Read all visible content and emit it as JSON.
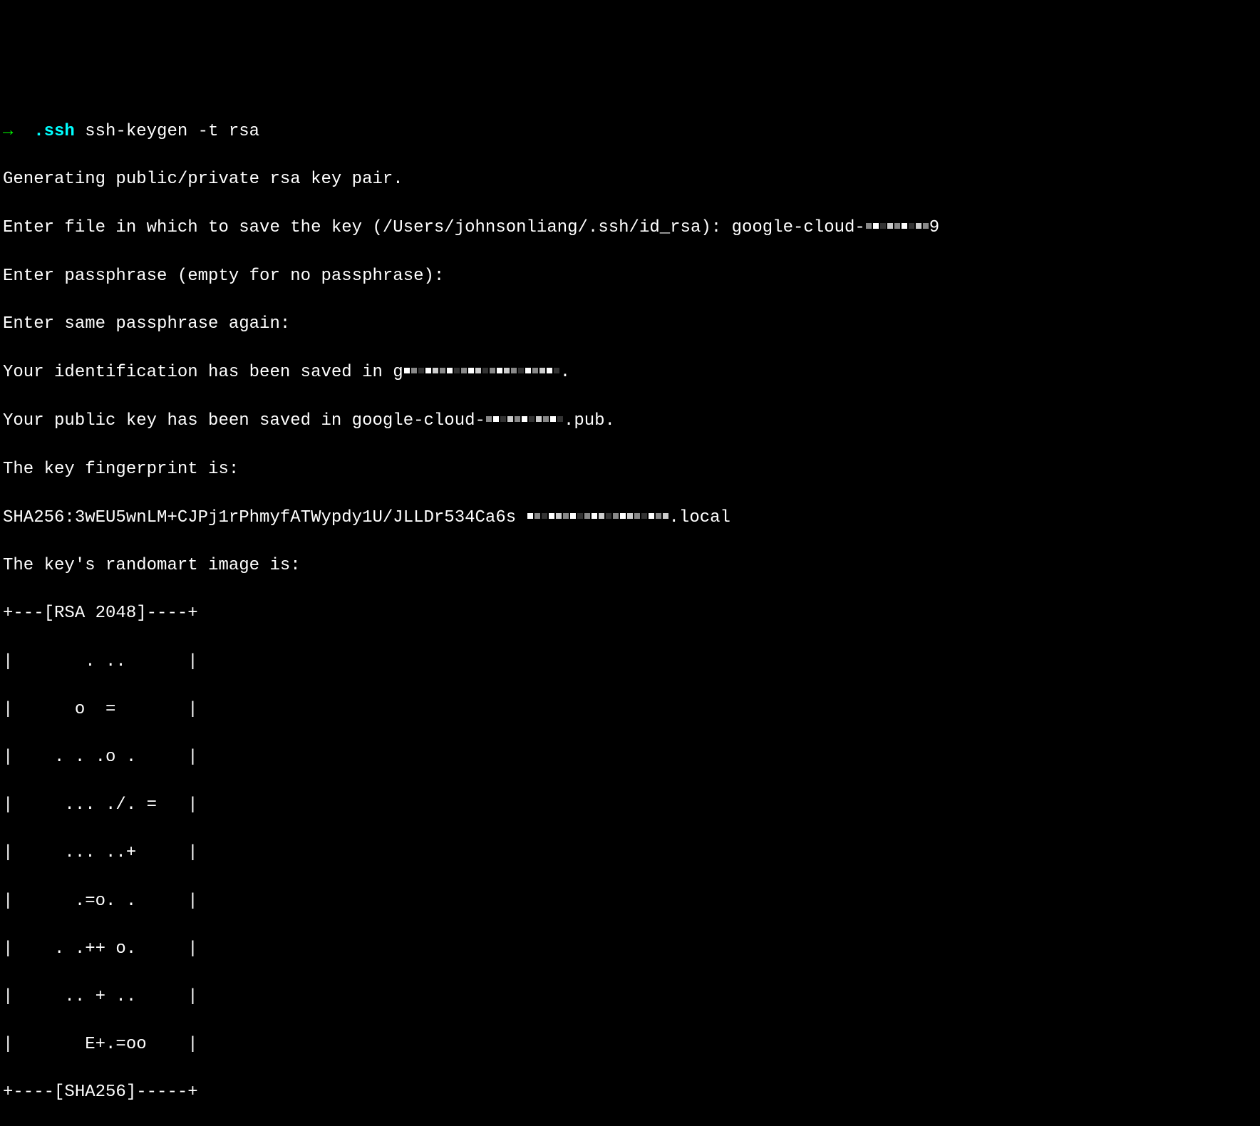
{
  "prompt": {
    "arrow": "→",
    "directory": ".ssh",
    "command": "ssh-keygen -t rsa"
  },
  "output": {
    "line1": "Generating public/private rsa key pair.",
    "line2_prefix": "Enter file in which to save the key (/Users/johnsonliang/.ssh/id_rsa): google-cloud-",
    "line2_suffix": "9",
    "line3": "Enter passphrase (empty for no passphrase):",
    "line4": "Enter same passphrase again:",
    "line5_prefix": "Your identification has been saved in g",
    "line5_suffix": ".",
    "line6_prefix": "Your public key has been saved in google-cloud-",
    "line6_suffix": ".pub.",
    "line7": "The key fingerprint is:",
    "line8_prefix": "SHA256:3wEU5wnLM+CJPj1rPhmyfATWypdy1U/JLLDr534Ca6s ",
    "line8_suffix": ".local",
    "line9": "The key's randomart image is:",
    "randomart": {
      "top": "+---[RSA 2048]----+",
      "r1": "|       . ..      |",
      "r2": "|      o  =       |",
      "r3": "|    . . .o .     |",
      "r4": "|     ... ./. =   |",
      "r5": "|     ... ..+     |",
      "r6": "|      .=o. .     |",
      "r7": "|    . .++ o.     |",
      "r8": "|     .. + ..     |",
      "r9": "|       E+.=oo    |",
      "bottom": "+----[SHA256]-----+"
    }
  }
}
